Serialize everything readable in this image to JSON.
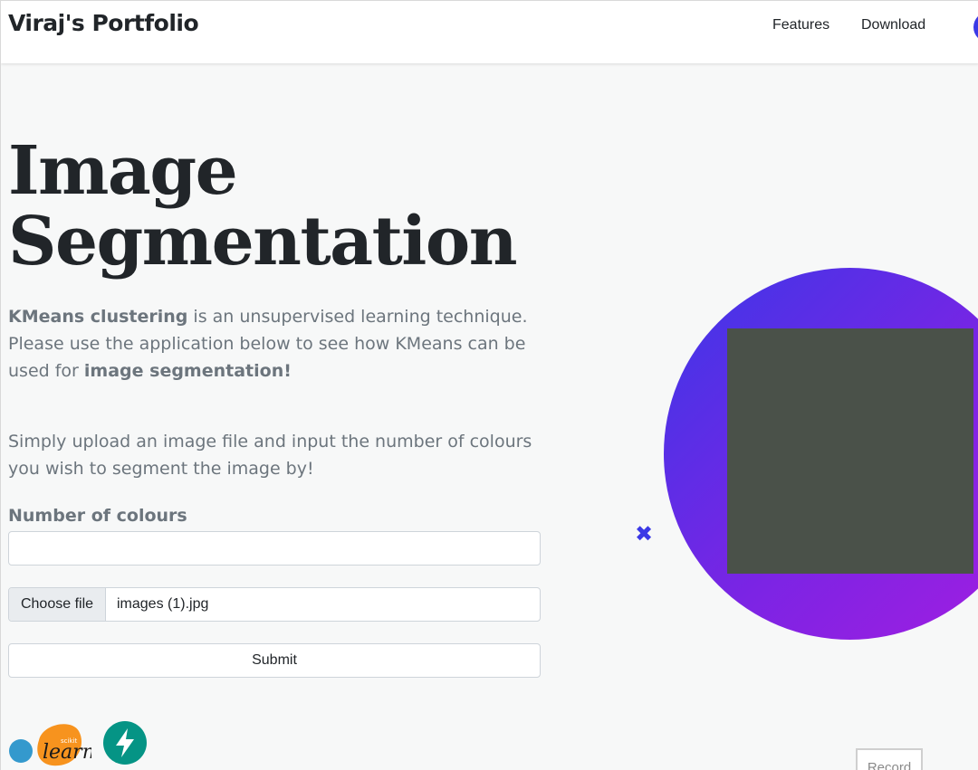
{
  "navbar": {
    "brand": "Viraj's Portfolio",
    "links": [
      "Features",
      "Download"
    ]
  },
  "hero": {
    "title_line1": "Image",
    "title_line2": "Segmentation",
    "intro_bold1": "KMeans clustering",
    "intro_text1": " is an unsupervised learning technique. Please use the application below to see how KMeans can be used for ",
    "intro_bold2": "image segmentation!",
    "instructions": "Simply upload an image file and input the number of colours you wish to segment the image by!"
  },
  "form": {
    "colours_label": "Number of colours",
    "colours_value": "",
    "choose_file_label": "Choose file",
    "file_name": "images (1).jpg",
    "submit_label": "Submit"
  },
  "logos": {
    "sklearn_text": "learn",
    "sklearn_small": "scikit"
  },
  "record": {
    "label": "Record"
  },
  "colors": {
    "accent": "#3b39e6",
    "gradient_start": "#3c37e8",
    "gradient_end": "#a41ee0",
    "preview_fill": "#4a5149",
    "sklearn_orange": "#f7931e",
    "sklearn_blue": "#3499cd",
    "fastapi_teal": "#059485"
  }
}
